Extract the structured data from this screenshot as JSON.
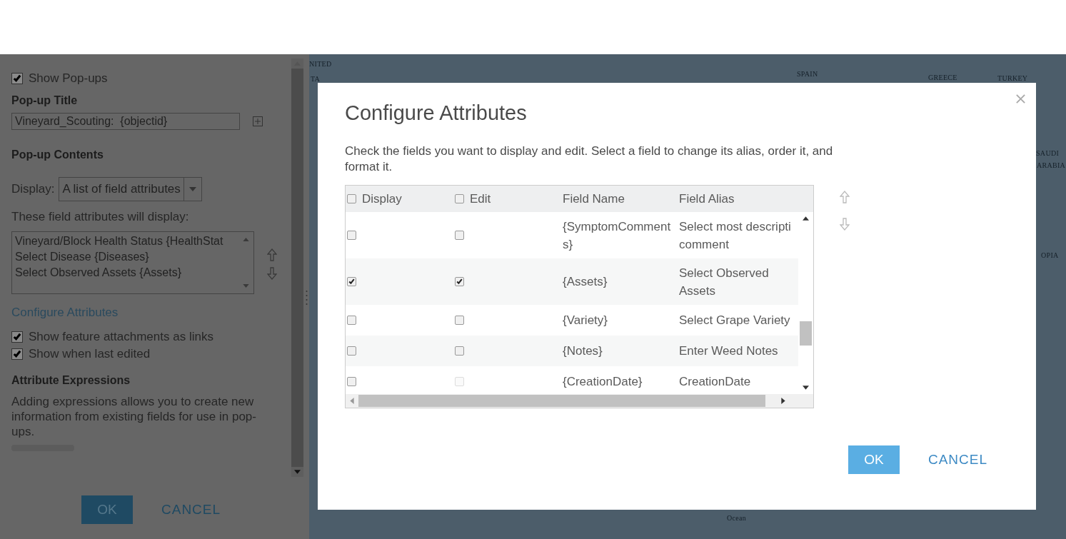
{
  "left_panel": {
    "show_popups": {
      "label": "Show Pop-ups",
      "checked": true
    },
    "title_heading": "Pop-up Title",
    "title_value": "Vineyard_Scouting:  {objectid}",
    "contents_heading": "Pop-up Contents",
    "display_label": "Display:",
    "display_value": "A list of field attributes",
    "attributes_label": "These field attributes will display:",
    "attribute_list": [
      "Vineyard/Block Health Status {HealthStat",
      "Select Disease {Diseases}",
      "Select Observed Assets {Assets}"
    ],
    "configure_link": "Configure Attributes",
    "options": [
      {
        "label": "Show feature attachments as links",
        "checked": true
      },
      {
        "label": "Show when last edited",
        "checked": true
      }
    ],
    "expressions_heading": "Attribute Expressions",
    "expressions_text": "Adding expressions allows you to create new information from existing fields for use in pop-ups.",
    "buttons": [
      "OK",
      "CANCEL"
    ]
  },
  "map": {
    "labels": [
      {
        "text": "NITED"
      },
      {
        "text": "TA"
      },
      {
        "text": "SPAIN"
      },
      {
        "text": "GREECE"
      },
      {
        "text": "TURKEY"
      },
      {
        "text": "SAUDI"
      },
      {
        "text": "ARABIA"
      },
      {
        "text": "OPIA"
      },
      {
        "text": "Ocean"
      }
    ]
  },
  "dialog": {
    "title": "Configure Attributes",
    "instructions": "Check the fields you want to display and edit. Select a field to change its alias, order it, and format it.",
    "columns": [
      {
        "label": "Display",
        "checked": false
      },
      {
        "label": "Edit",
        "checked": false
      },
      {
        "label": "Field Name"
      },
      {
        "label": "Field Alias"
      }
    ],
    "rows": [
      {
        "field_name": "{SymptomComment\ns}",
        "field_alias": "Select most descripti\ncomment",
        "display": false,
        "edit": false,
        "edit_disabled": false
      },
      {
        "field_name": "{Assets}",
        "field_alias": "Select Observed\nAssets",
        "display": true,
        "edit": true,
        "edit_disabled": false
      },
      {
        "field_name": "{Variety}",
        "field_alias": "Select Grape Variety",
        "display": false,
        "edit": false,
        "edit_disabled": false
      },
      {
        "field_name": "{Notes}",
        "field_alias": "Enter Weed Notes",
        "display": false,
        "edit": false,
        "edit_disabled": false
      },
      {
        "field_name": "{CreationDate}",
        "field_alias": "CreationDate",
        "display": false,
        "edit": false,
        "edit_disabled": true
      }
    ],
    "buttons": [
      "OK",
      "CANCEL"
    ]
  }
}
